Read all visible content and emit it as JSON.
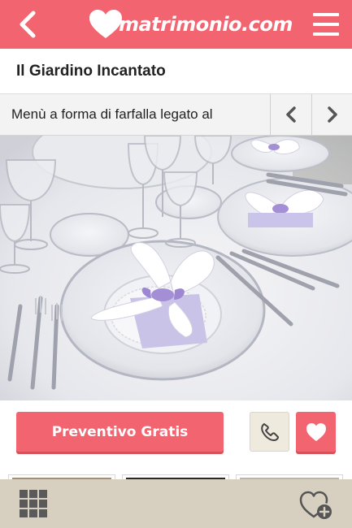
{
  "header": {
    "logo_text": "matrimonio.com",
    "back_icon": "chevron-left-icon",
    "menu_icon": "hamburger-menu-icon",
    "brand_color": "#f26570"
  },
  "venue": {
    "title": "Il Giardino Incantato"
  },
  "gallery": {
    "caption": "Menù a forma di farfalla legato al",
    "prev_icon": "chevron-left-icon",
    "next_icon": "chevron-right-icon"
  },
  "actions": {
    "quote_label": "Preventivo Gratis",
    "phone_icon": "phone-icon",
    "favorite_icon": "heart-icon"
  },
  "bottom_nav": {
    "grid_icon": "grid-icon",
    "add_favorite_icon": "heart-plus-icon",
    "bar_color": "#d7cfc0"
  }
}
